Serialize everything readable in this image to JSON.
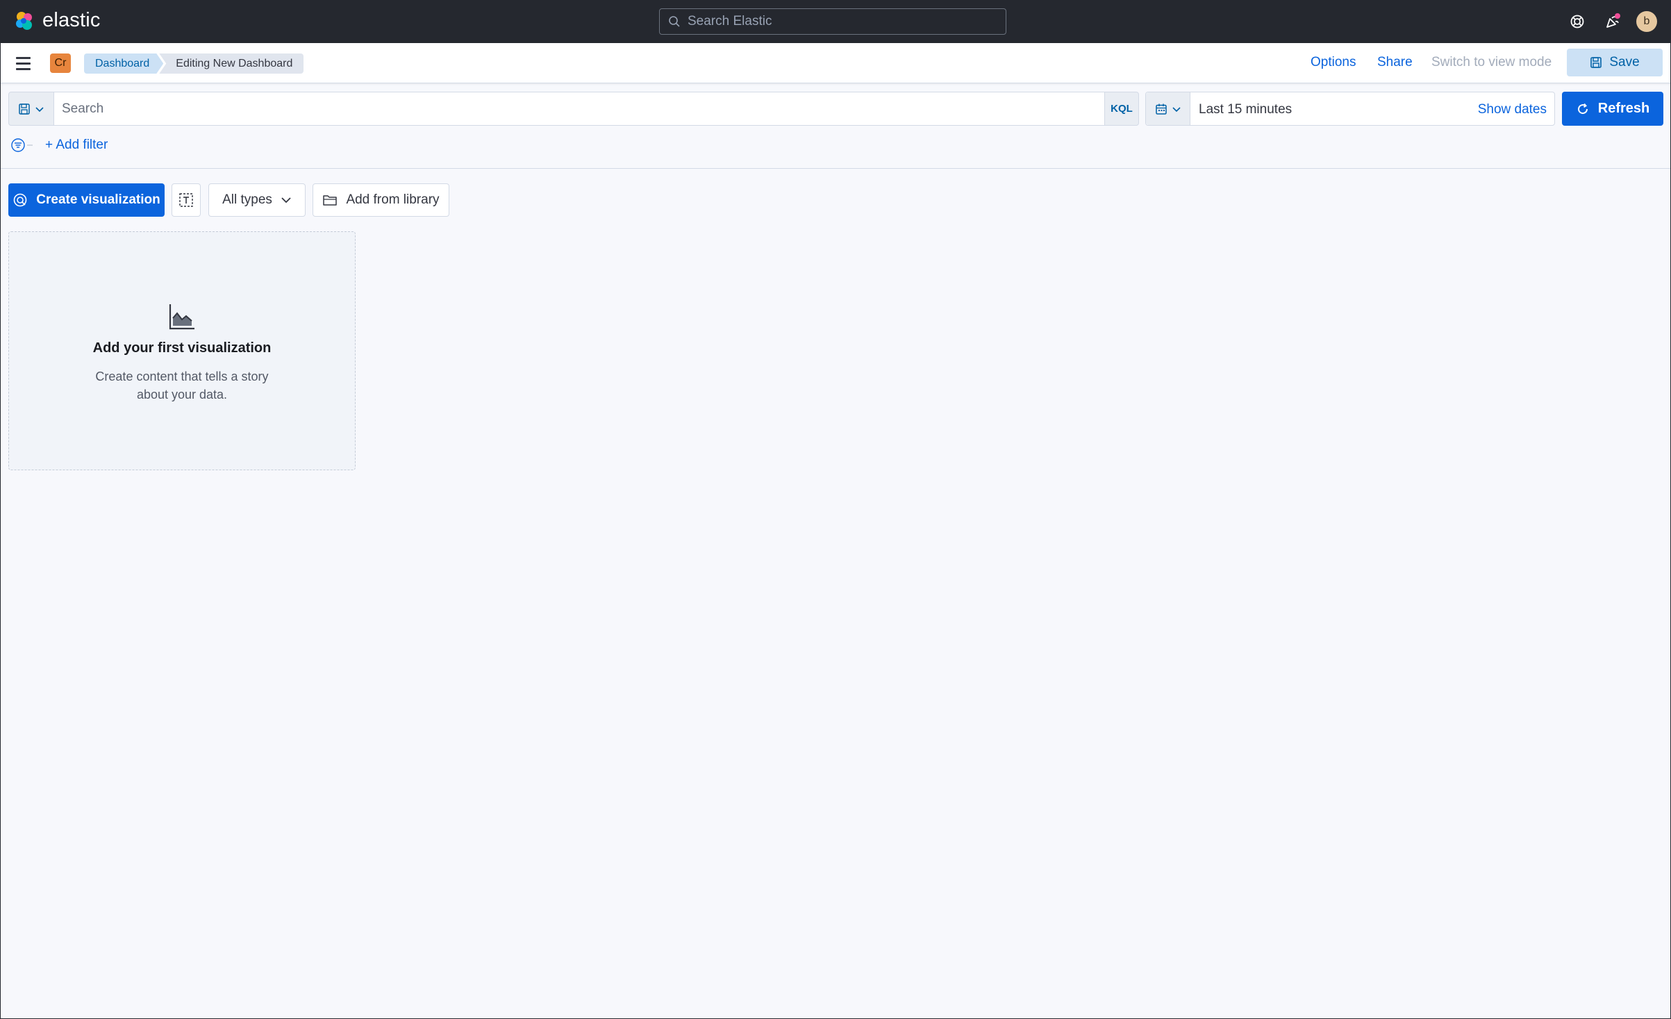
{
  "header": {
    "logo_text": "elastic",
    "search_placeholder": "Search Elastic",
    "avatar_initial": "b",
    "colors": {
      "background": "#25282f",
      "notification_dot": "#f04e98"
    }
  },
  "subheader": {
    "space_badge": "Cr",
    "breadcrumbs": [
      "Dashboard",
      "Editing New Dashboard"
    ],
    "options_label": "Options",
    "share_label": "Share",
    "switch_mode_label": "Switch to view mode",
    "save_label": "Save"
  },
  "query_bar": {
    "search_placeholder": "Search",
    "language_label": "KQL",
    "time_range": "Last 15 minutes",
    "show_dates_label": "Show dates",
    "refresh_label": "Refresh",
    "add_filter_label": "+ Add filter"
  },
  "toolbar": {
    "create_label": "Create visualization",
    "types_label": "All types",
    "library_label": "Add from library",
    "accent_color": "#0b64dd"
  },
  "empty_panel": {
    "title": "Add your first visualization",
    "description": "Create content that tells a story about your data."
  }
}
